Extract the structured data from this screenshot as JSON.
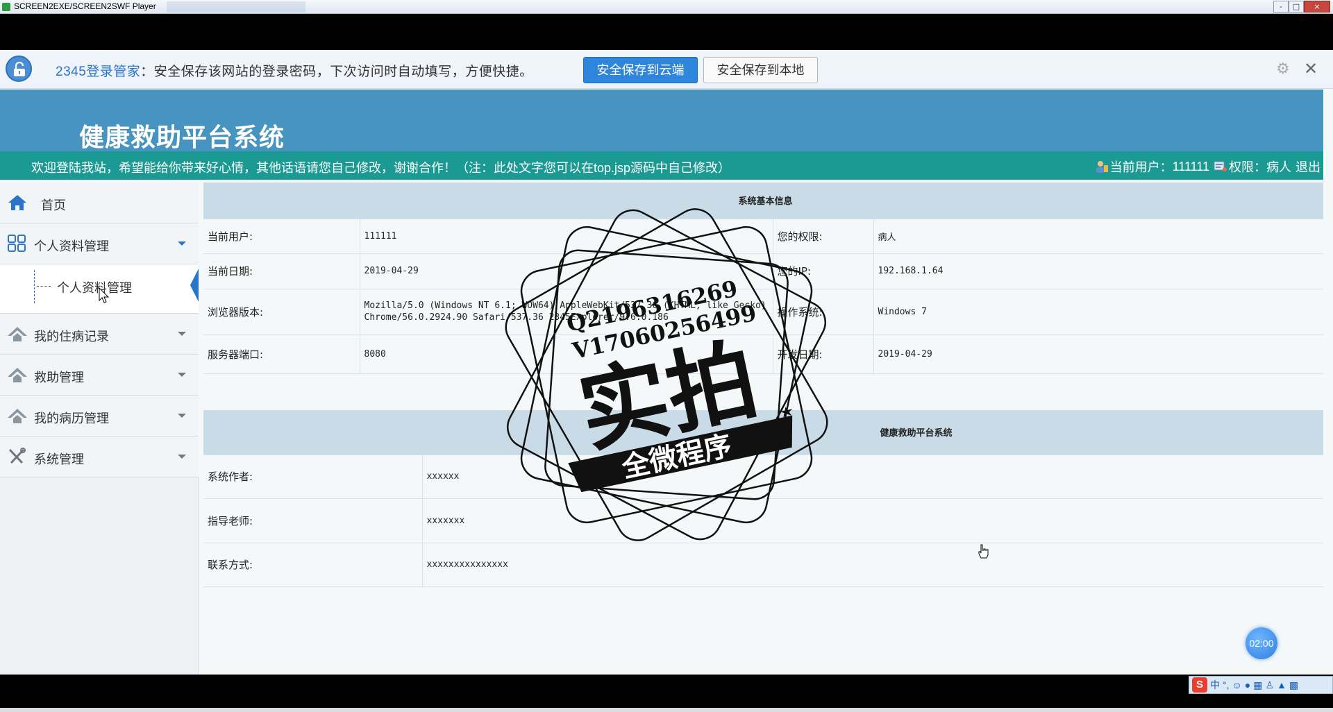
{
  "player": {
    "title": "SCREEN2EXE/SCREEN2SWF Player",
    "window_buttons": [
      "-",
      "□",
      "×"
    ]
  },
  "password_bar": {
    "brand": "2345登录管家",
    "message": "：安全保存该网站的登录密码，下次访问时自动填写，方便快捷。",
    "save_cloud_label": "安全保存到云端",
    "save_local_label": "安全保存到本地",
    "gear_icon": "gear-icon",
    "close_icon": "close-icon"
  },
  "header": {
    "title": "健康救助平台系统"
  },
  "welcome_bar": {
    "text": "欢迎登陆我站，希望能给你带来好心情，其他话语请您自己修改，谢谢合作！（注：此处文字您可以在top.jsp源码中自己修改）",
    "current_user_label": "当前用户：",
    "current_user": "111111",
    "role_label": "权限：",
    "role": "病人",
    "logout_label": "退出"
  },
  "sidebar": {
    "items": [
      {
        "label": "首页",
        "icon": "home-icon"
      },
      {
        "label": "个人资料管理",
        "icon": "grid-icon"
      },
      {
        "label": "我的住病记录",
        "icon": "house-icon"
      },
      {
        "label": "救助管理",
        "icon": "house-icon"
      },
      {
        "label": "我的病历管理",
        "icon": "house-icon"
      },
      {
        "label": "系统管理",
        "icon": "tools-icon"
      }
    ],
    "submenu": {
      "label": "个人资料管理"
    }
  },
  "system_info": {
    "heading": "系统基本信息",
    "rows": [
      {
        "label1": "当前用户:",
        "value1": "111111",
        "label2": "您的权限:",
        "value2": "病人"
      },
      {
        "label1": "当前日期:",
        "value1": "2019-04-29",
        "label2": "您的IP:",
        "value2": "192.168.1.64"
      },
      {
        "label1": "浏览器版本:",
        "value1": "Mozilla/5.0 (Windows NT 6.1; WOW64) AppleWebKit/537.36 (KHTML, like Gecko) Chrome/56.0.2924.90 Safari/537.36 2345Explorer/9.6.0.186",
        "label2": "操作系统:",
        "value2": "Windows 7"
      },
      {
        "label1": "服务器端口:",
        "value1": "8080",
        "label2": "开发日期:",
        "value2": "2019-04-29"
      }
    ]
  },
  "platform_info": {
    "heading": "健康救助平台系统",
    "rows": [
      {
        "label": "系统作者:",
        "value": "xxxxxx"
      },
      {
        "label": "指导老师:",
        "value": "xxxxxxx"
      },
      {
        "label": "联系方式:",
        "value": "xxxxxxxxxxxxxxx"
      }
    ]
  },
  "watermark": {
    "qq": "Q2196316269",
    "wx": "V17060256499",
    "big": "实拍",
    "ribbon": "全微程序"
  },
  "timer": {
    "label": "02:00"
  },
  "tray": {
    "ime": "中"
  }
}
